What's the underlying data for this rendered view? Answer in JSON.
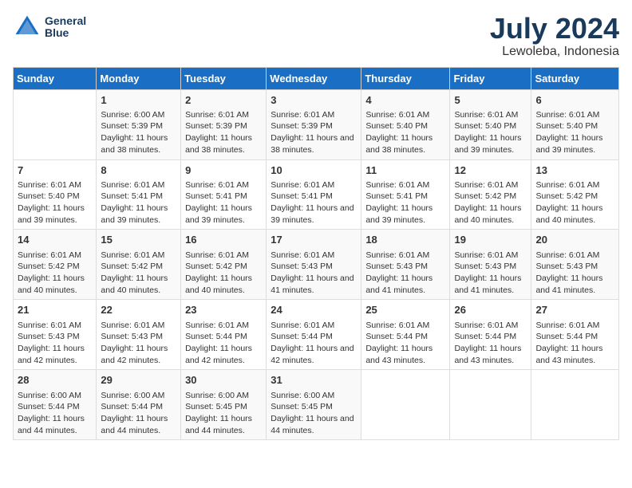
{
  "logo": {
    "line1": "General",
    "line2": "Blue"
  },
  "title": "July 2024",
  "subtitle": "Lewoleba, Indonesia",
  "days_of_week": [
    "Sunday",
    "Monday",
    "Tuesday",
    "Wednesday",
    "Thursday",
    "Friday",
    "Saturday"
  ],
  "weeks": [
    [
      {
        "day": "",
        "sunrise": "",
        "sunset": "",
        "daylight": ""
      },
      {
        "day": "1",
        "sunrise": "Sunrise: 6:00 AM",
        "sunset": "Sunset: 5:39 PM",
        "daylight": "Daylight: 11 hours and 38 minutes."
      },
      {
        "day": "2",
        "sunrise": "Sunrise: 6:01 AM",
        "sunset": "Sunset: 5:39 PM",
        "daylight": "Daylight: 11 hours and 38 minutes."
      },
      {
        "day": "3",
        "sunrise": "Sunrise: 6:01 AM",
        "sunset": "Sunset: 5:39 PM",
        "daylight": "Daylight: 11 hours and 38 minutes."
      },
      {
        "day": "4",
        "sunrise": "Sunrise: 6:01 AM",
        "sunset": "Sunset: 5:40 PM",
        "daylight": "Daylight: 11 hours and 38 minutes."
      },
      {
        "day": "5",
        "sunrise": "Sunrise: 6:01 AM",
        "sunset": "Sunset: 5:40 PM",
        "daylight": "Daylight: 11 hours and 39 minutes."
      },
      {
        "day": "6",
        "sunrise": "Sunrise: 6:01 AM",
        "sunset": "Sunset: 5:40 PM",
        "daylight": "Daylight: 11 hours and 39 minutes."
      }
    ],
    [
      {
        "day": "7",
        "sunrise": "Sunrise: 6:01 AM",
        "sunset": "Sunset: 5:40 PM",
        "daylight": "Daylight: 11 hours and 39 minutes."
      },
      {
        "day": "8",
        "sunrise": "Sunrise: 6:01 AM",
        "sunset": "Sunset: 5:41 PM",
        "daylight": "Daylight: 11 hours and 39 minutes."
      },
      {
        "day": "9",
        "sunrise": "Sunrise: 6:01 AM",
        "sunset": "Sunset: 5:41 PM",
        "daylight": "Daylight: 11 hours and 39 minutes."
      },
      {
        "day": "10",
        "sunrise": "Sunrise: 6:01 AM",
        "sunset": "Sunset: 5:41 PM",
        "daylight": "Daylight: 11 hours and 39 minutes."
      },
      {
        "day": "11",
        "sunrise": "Sunrise: 6:01 AM",
        "sunset": "Sunset: 5:41 PM",
        "daylight": "Daylight: 11 hours and 39 minutes."
      },
      {
        "day": "12",
        "sunrise": "Sunrise: 6:01 AM",
        "sunset": "Sunset: 5:42 PM",
        "daylight": "Daylight: 11 hours and 40 minutes."
      },
      {
        "day": "13",
        "sunrise": "Sunrise: 6:01 AM",
        "sunset": "Sunset: 5:42 PM",
        "daylight": "Daylight: 11 hours and 40 minutes."
      }
    ],
    [
      {
        "day": "14",
        "sunrise": "Sunrise: 6:01 AM",
        "sunset": "Sunset: 5:42 PM",
        "daylight": "Daylight: 11 hours and 40 minutes."
      },
      {
        "day": "15",
        "sunrise": "Sunrise: 6:01 AM",
        "sunset": "Sunset: 5:42 PM",
        "daylight": "Daylight: 11 hours and 40 minutes."
      },
      {
        "day": "16",
        "sunrise": "Sunrise: 6:01 AM",
        "sunset": "Sunset: 5:42 PM",
        "daylight": "Daylight: 11 hours and 40 minutes."
      },
      {
        "day": "17",
        "sunrise": "Sunrise: 6:01 AM",
        "sunset": "Sunset: 5:43 PM",
        "daylight": "Daylight: 11 hours and 41 minutes."
      },
      {
        "day": "18",
        "sunrise": "Sunrise: 6:01 AM",
        "sunset": "Sunset: 5:43 PM",
        "daylight": "Daylight: 11 hours and 41 minutes."
      },
      {
        "day": "19",
        "sunrise": "Sunrise: 6:01 AM",
        "sunset": "Sunset: 5:43 PM",
        "daylight": "Daylight: 11 hours and 41 minutes."
      },
      {
        "day": "20",
        "sunrise": "Sunrise: 6:01 AM",
        "sunset": "Sunset: 5:43 PM",
        "daylight": "Daylight: 11 hours and 41 minutes."
      }
    ],
    [
      {
        "day": "21",
        "sunrise": "Sunrise: 6:01 AM",
        "sunset": "Sunset: 5:43 PM",
        "daylight": "Daylight: 11 hours and 42 minutes."
      },
      {
        "day": "22",
        "sunrise": "Sunrise: 6:01 AM",
        "sunset": "Sunset: 5:43 PM",
        "daylight": "Daylight: 11 hours and 42 minutes."
      },
      {
        "day": "23",
        "sunrise": "Sunrise: 6:01 AM",
        "sunset": "Sunset: 5:44 PM",
        "daylight": "Daylight: 11 hours and 42 minutes."
      },
      {
        "day": "24",
        "sunrise": "Sunrise: 6:01 AM",
        "sunset": "Sunset: 5:44 PM",
        "daylight": "Daylight: 11 hours and 42 minutes."
      },
      {
        "day": "25",
        "sunrise": "Sunrise: 6:01 AM",
        "sunset": "Sunset: 5:44 PM",
        "daylight": "Daylight: 11 hours and 43 minutes."
      },
      {
        "day": "26",
        "sunrise": "Sunrise: 6:01 AM",
        "sunset": "Sunset: 5:44 PM",
        "daylight": "Daylight: 11 hours and 43 minutes."
      },
      {
        "day": "27",
        "sunrise": "Sunrise: 6:01 AM",
        "sunset": "Sunset: 5:44 PM",
        "daylight": "Daylight: 11 hours and 43 minutes."
      }
    ],
    [
      {
        "day": "28",
        "sunrise": "Sunrise: 6:00 AM",
        "sunset": "Sunset: 5:44 PM",
        "daylight": "Daylight: 11 hours and 44 minutes."
      },
      {
        "day": "29",
        "sunrise": "Sunrise: 6:00 AM",
        "sunset": "Sunset: 5:44 PM",
        "daylight": "Daylight: 11 hours and 44 minutes."
      },
      {
        "day": "30",
        "sunrise": "Sunrise: 6:00 AM",
        "sunset": "Sunset: 5:45 PM",
        "daylight": "Daylight: 11 hours and 44 minutes."
      },
      {
        "day": "31",
        "sunrise": "Sunrise: 6:00 AM",
        "sunset": "Sunset: 5:45 PM",
        "daylight": "Daylight: 11 hours and 44 minutes."
      },
      {
        "day": "",
        "sunrise": "",
        "sunset": "",
        "daylight": ""
      },
      {
        "day": "",
        "sunrise": "",
        "sunset": "",
        "daylight": ""
      },
      {
        "day": "",
        "sunrise": "",
        "sunset": "",
        "daylight": ""
      }
    ]
  ]
}
